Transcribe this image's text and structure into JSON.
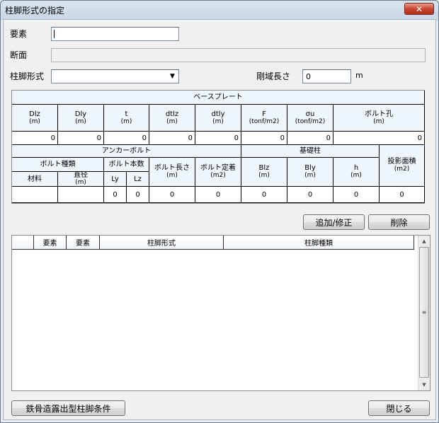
{
  "window": {
    "title": "柱脚形式の指定",
    "close_glyph": "✕"
  },
  "form": {
    "element_label": "要素",
    "element_value": "",
    "section_label": "断面",
    "section_value": "",
    "base_type_label": "柱脚形式",
    "base_type_value": "",
    "rigid_length_label": "剛域長さ",
    "rigid_length_value": "0",
    "rigid_length_unit": "m"
  },
  "grid": {
    "base_plate_title": "ベースプレート",
    "base_plate_cols": [
      {
        "label": "Dlz",
        "unit": "(m)",
        "value": "0"
      },
      {
        "label": "Dly",
        "unit": "(m)",
        "value": "0"
      },
      {
        "label": "t",
        "unit": "(m)",
        "value": "0"
      },
      {
        "label": "dtlz",
        "unit": "(m)",
        "value": "0"
      },
      {
        "label": "dtly",
        "unit": "(m)",
        "value": "0"
      },
      {
        "label": "F",
        "unit": "(tonf/m2)",
        "value": "0"
      },
      {
        "label": "σu",
        "unit": "(tonf/m2)",
        "value": "0"
      },
      {
        "label": "ボルト孔",
        "unit": "(m)",
        "value": "0"
      }
    ],
    "anchor_bolt_title": "アンカーボルト",
    "foundation_title": "基礎柱",
    "bolt_type_title": "ボルト種類",
    "bolt_count_title": "ボルト本数",
    "material_label": "材料",
    "diameter_label": "直径",
    "diameter_unit": "(m)",
    "ly_label": "Ly",
    "lz_label": "Lz",
    "bolt_length_label": "ボルト長さ",
    "bolt_length_unit": "(m)",
    "bolt_anchorage_label": "ボルト定着",
    "bolt_anchorage_unit": "(m2)",
    "blz_label": "Blz",
    "blz_unit": "(m)",
    "bly_label": "Bly",
    "bly_unit": "(m)",
    "h_label": "h",
    "h_unit": "(m)",
    "projected_area_label": "投影面積",
    "projected_area_unit": "(m2)",
    "row2_values": {
      "material": "",
      "diameter": "",
      "ly": "0",
      "lz": "0",
      "bolt_length": "0",
      "bolt_anchorage": "0",
      "blz": "0",
      "bly": "0",
      "h": "0",
      "projected_area": "0"
    }
  },
  "buttons": {
    "add_modify": "追加/修正",
    "delete": "削除",
    "steel_exposed": "鉄骨造露出型柱脚条件",
    "close": "閉じる"
  },
  "list": {
    "columns": [
      "",
      "要素",
      "要素",
      "柱脚形式",
      "柱脚種類"
    ],
    "scroll_up": "▲",
    "scroll_down": "▼",
    "thumb_grip": "≡"
  }
}
